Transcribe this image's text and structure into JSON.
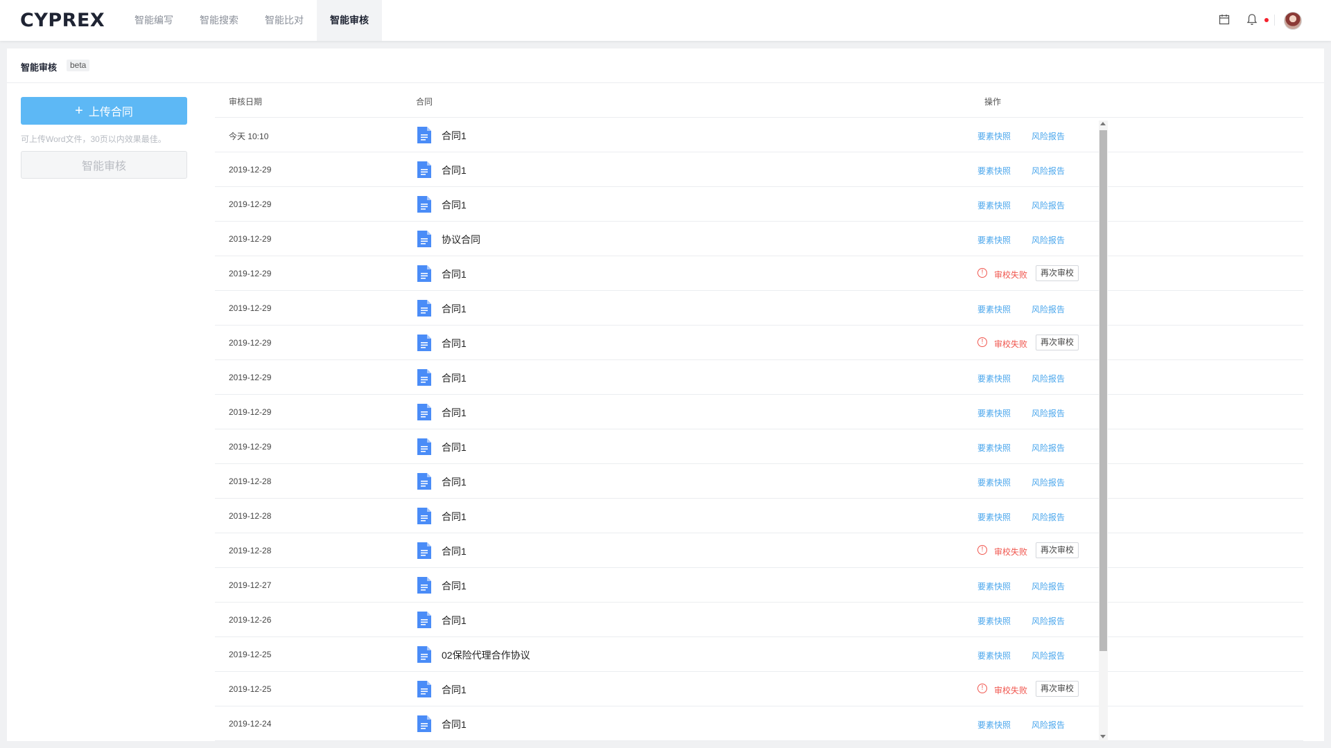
{
  "app": {
    "logo": "CYPREX"
  },
  "nav": {
    "items": [
      {
        "label": "智能编写",
        "active": false
      },
      {
        "label": "智能搜索",
        "active": false
      },
      {
        "label": "智能比对",
        "active": false
      },
      {
        "label": "智能审核",
        "active": true
      }
    ]
  },
  "top_icons": [
    "calendar-icon",
    "bell-icon",
    "avatar"
  ],
  "colors": {
    "accent": "#5db8f5",
    "link": "#4aa6ec",
    "error": "#f0564e",
    "doc_icon": "#4a8cf7",
    "notify_dot": "#f5222d"
  },
  "page": {
    "title": "智能审核",
    "badge": "beta"
  },
  "sidebar": {
    "upload_label": "上传合同",
    "upload_hint": "可上传Word文件，30页以内效果最佳。",
    "review_label": "智能审核"
  },
  "table": {
    "columns": {
      "date": "审核日期",
      "contract": "合同",
      "ops": "操作"
    },
    "actions": {
      "snapshot": "要素快照",
      "report": "风险报告",
      "fail": "审校失败",
      "retry": "再次审校"
    },
    "rows": [
      {
        "date": "今天 10:10",
        "name": "合同1",
        "status": "ok"
      },
      {
        "date": "2019-12-29",
        "name": "合同1",
        "status": "ok"
      },
      {
        "date": "2019-12-29",
        "name": "合同1",
        "status": "ok"
      },
      {
        "date": "2019-12-29",
        "name": "协议合同",
        "status": "ok"
      },
      {
        "date": "2019-12-29",
        "name": "合同1",
        "status": "fail"
      },
      {
        "date": "2019-12-29",
        "name": "合同1",
        "status": "ok"
      },
      {
        "date": "2019-12-29",
        "name": "合同1",
        "status": "fail"
      },
      {
        "date": "2019-12-29",
        "name": "合同1",
        "status": "ok"
      },
      {
        "date": "2019-12-29",
        "name": "合同1",
        "status": "ok"
      },
      {
        "date": "2019-12-29",
        "name": "合同1",
        "status": "ok"
      },
      {
        "date": "2019-12-28",
        "name": "合同1",
        "status": "ok"
      },
      {
        "date": "2019-12-28",
        "name": "合同1",
        "status": "ok"
      },
      {
        "date": "2019-12-28",
        "name": "合同1",
        "status": "fail"
      },
      {
        "date": "2019-12-27",
        "name": "合同1",
        "status": "ok"
      },
      {
        "date": "2019-12-26",
        "name": "合同1",
        "status": "ok"
      },
      {
        "date": "2019-12-25",
        "name": "02保险代理合作协议",
        "status": "ok"
      },
      {
        "date": "2019-12-25",
        "name": "合同1",
        "status": "fail"
      },
      {
        "date": "2019-12-24",
        "name": "合同1",
        "status": "ok"
      }
    ]
  }
}
